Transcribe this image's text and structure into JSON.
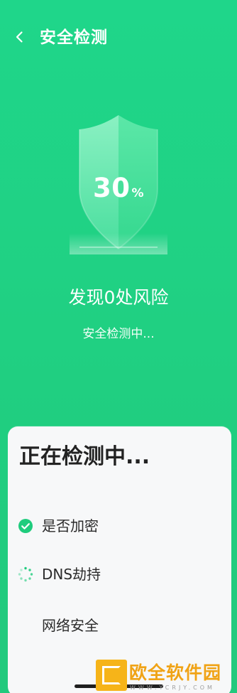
{
  "header": {
    "title": "安全检测",
    "back_icon": "chevron-left-icon"
  },
  "scan": {
    "progress_percent": 30,
    "progress_value": "30",
    "progress_unit": "%",
    "risk_text": "发现0处风险",
    "status_text": "安全检测中..."
  },
  "panel": {
    "title": "正在检测中...",
    "items": [
      {
        "label": "是否加密",
        "state": "done",
        "icon": "check-circle-icon"
      },
      {
        "label": "DNS劫持",
        "state": "loading",
        "icon": "loading-spinner-icon"
      },
      {
        "label": "网络安全",
        "state": "pending",
        "icon": ""
      }
    ]
  },
  "watermark": {
    "text": "欧全软件园",
    "url": "WWW.YCRJY.COM"
  },
  "colors": {
    "background": "#20cf81",
    "success": "#1fcc7d",
    "panel_bg": "#f7f8f9",
    "watermark": "#f6b419"
  }
}
